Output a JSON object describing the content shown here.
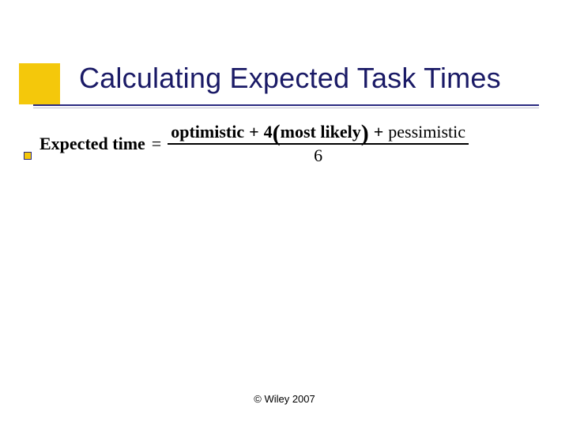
{
  "slide": {
    "title": "Calculating Expected Task Times",
    "footer": "© Wiley 2007"
  },
  "formula": {
    "lhs": "Expected time",
    "equals": "=",
    "numerator": {
      "term1": "optimistic",
      "plus1": "+",
      "coeff": "4",
      "paren_open": "(",
      "term2": "most likely",
      "paren_close": ")",
      "plus2": "+",
      "term3": "pessimistic"
    },
    "denominator": "6"
  }
}
